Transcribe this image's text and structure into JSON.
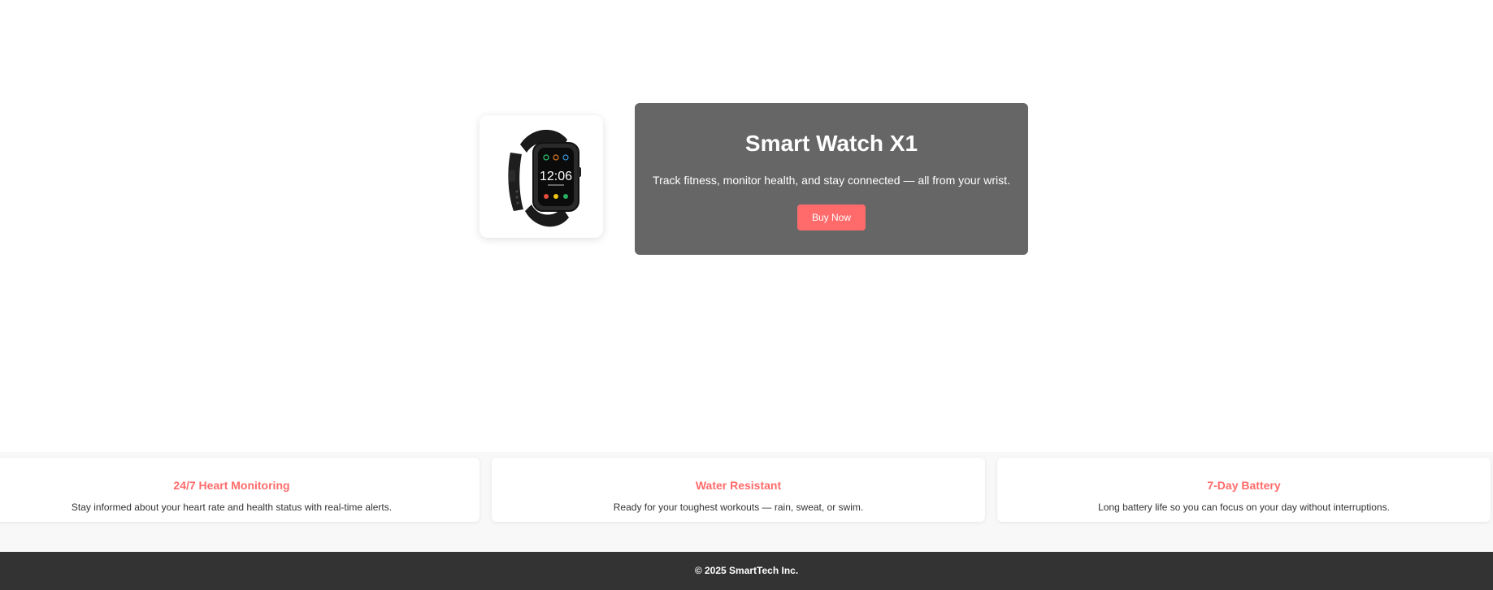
{
  "hero": {
    "product_name": "Smart Watch X1",
    "tagline": "Track fitness, monitor health, and stay connected — all from your wrist.",
    "buy_label": "Buy Now",
    "watch_time": "12:06",
    "accent_color": "#ff6b6b",
    "panel_color": "#666666"
  },
  "features": [
    {
      "title": "24/7 Heart Monitoring",
      "description": "Stay informed about your heart rate and health status with real-time alerts."
    },
    {
      "title": "Water Resistant",
      "description": "Ready for your toughest workouts — rain, sweat, or swim."
    },
    {
      "title": "7-Day Battery",
      "description": "Long battery life so you can focus on your day without interruptions."
    }
  ],
  "footer": {
    "copyright": "© 2025 SmartTech Inc."
  }
}
